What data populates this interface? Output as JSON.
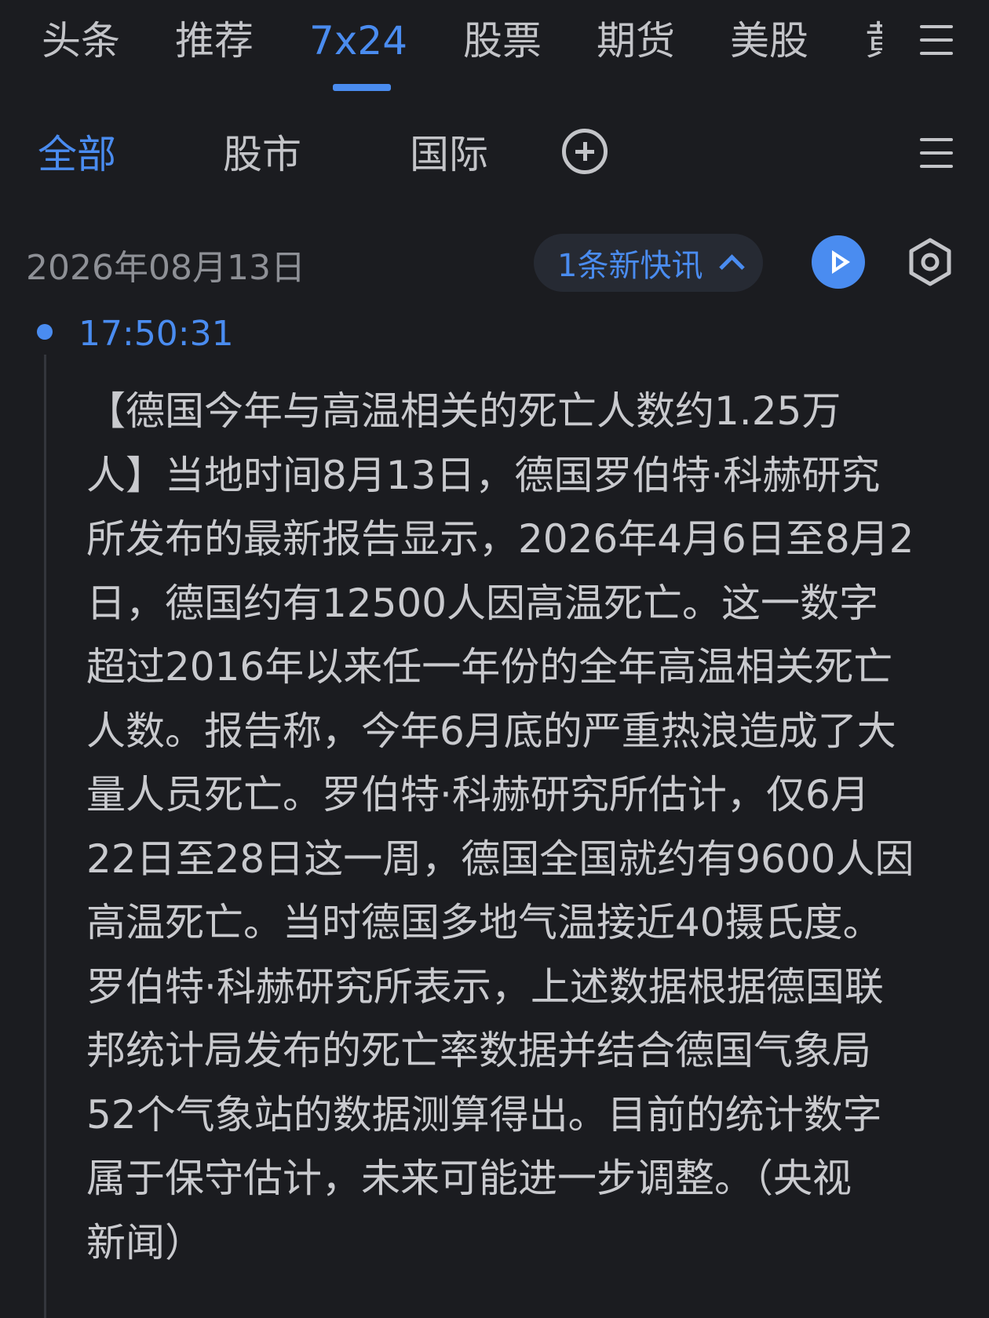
{
  "top_tabs": [
    "头条",
    "推荐",
    "7x24",
    "股票",
    "期货",
    "美股",
    "黄"
  ],
  "active_top_tab": "7x24",
  "sub_tabs": [
    "全部",
    "股市",
    "国际"
  ],
  "active_sub_tab": "全部",
  "date": "2026年08月13日",
  "new_flash": "1条新快讯",
  "item": {
    "time": "17:50:31",
    "lines": [
      "【德国今年与高温相关的死亡人数约1.25万",
      "人】当地时间8月13日，德国罗伯特·科赫研究",
      "所发布的最新报告显示，2026年4月6日至8月2",
      "日，德国约有12500人因高温死亡。这一数字",
      "超过2016年以来任一年份的全年高温相关死亡",
      "人数。报告称，今年6月底的严重热浪造成了大",
      "量人员死亡。罗伯特·科赫研究所估计，仅6月",
      "22日至28日这一周，德国全国就约有9600人因",
      "高温死亡。当时德国多地气温接近40摄氏度。",
      "罗伯特·科赫研究所表示，上述数据根据德国联",
      "邦统计局发布的死亡率数据并结合德国气象局",
      "52个气象站的数据测算得出。目前的统计数字",
      "属于保守估计，未来可能进一步调整。（央视",
      "新闻）"
    ]
  },
  "colors": {
    "background": "#1b1c20",
    "accent": "#4a8cf0",
    "text": "#c9cace",
    "muted": "#8e9096"
  }
}
